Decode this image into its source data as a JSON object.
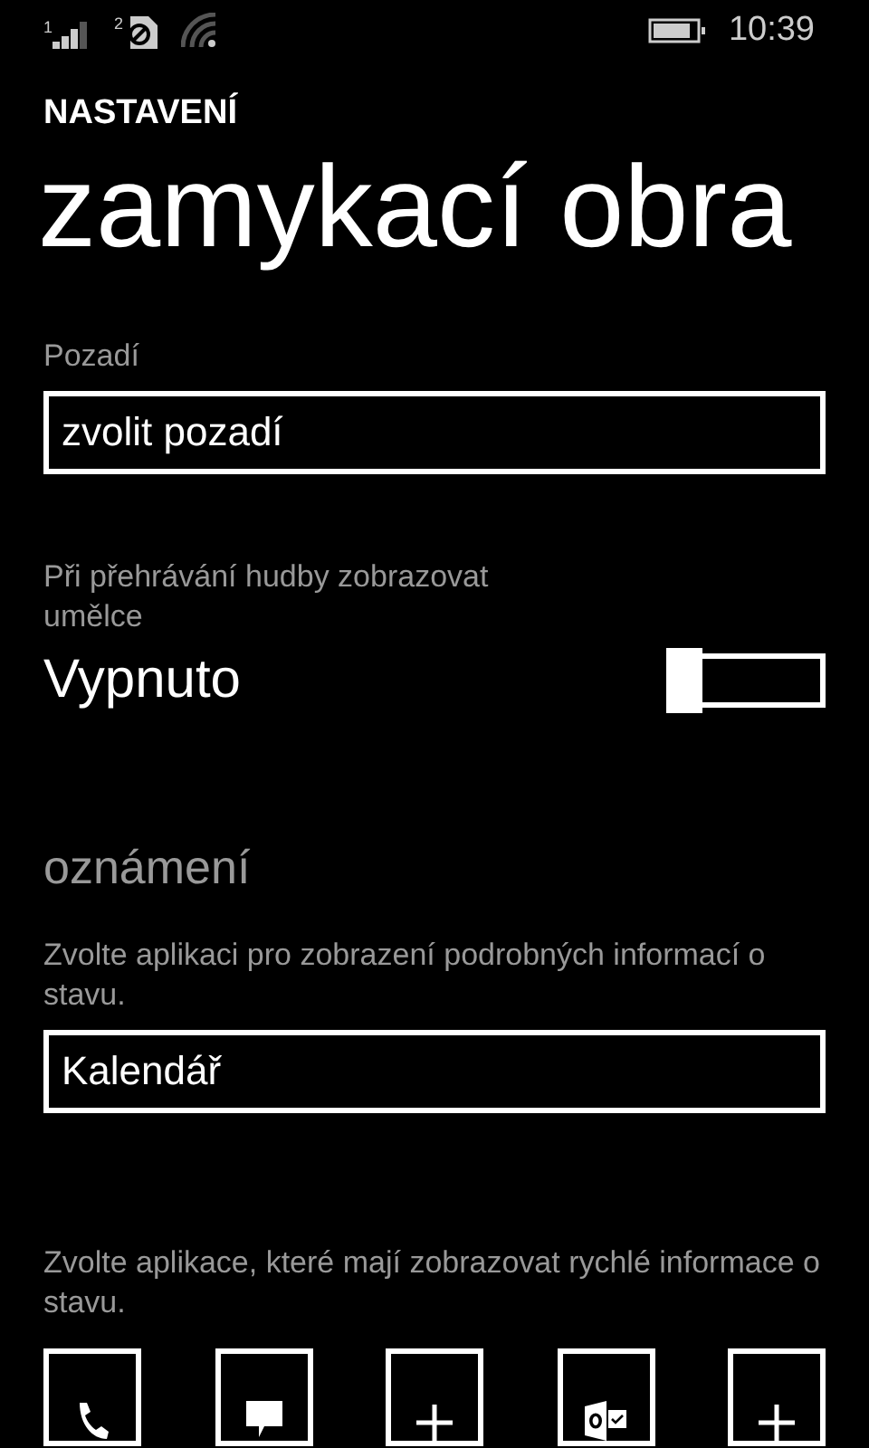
{
  "status_bar": {
    "sim1_label": "1",
    "sim2_label": "2",
    "time": "10:39"
  },
  "header": {
    "app": "NASTAVENÍ",
    "title": "zamykací obra"
  },
  "background": {
    "label": "Pozadí",
    "value": "zvolit pozadí"
  },
  "music_artist": {
    "label": "Při přehrávání hudby zobrazovat umělce",
    "state_text": "Vypnuto",
    "on": false
  },
  "notifications": {
    "heading": "oznámení",
    "detail_label": "Zvolte aplikaci pro zobrazení podrobných informací o stavu.",
    "detail_value": "Kalendář",
    "quick_label": "Zvolte aplikace, které mají zobrazovat rychlé informace o stavu.",
    "quick_apps": [
      {
        "kind": "phone"
      },
      {
        "kind": "message"
      },
      {
        "kind": "add"
      },
      {
        "kind": "outlook"
      },
      {
        "kind": "add"
      }
    ]
  }
}
